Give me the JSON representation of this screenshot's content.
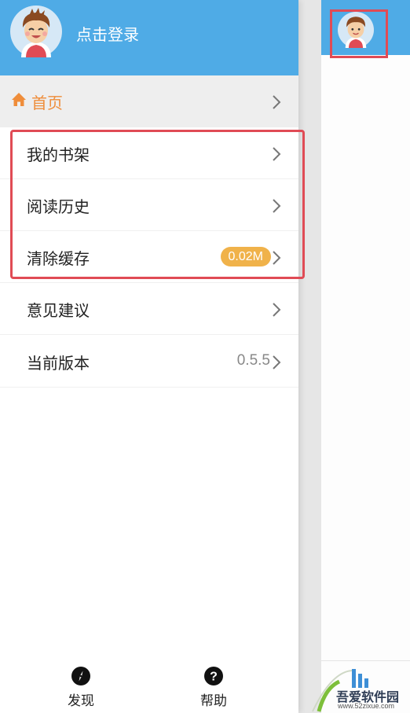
{
  "header": {
    "login_label": "点击登录"
  },
  "menu": {
    "home_label": "首页",
    "items": [
      {
        "label": "我的书架"
      },
      {
        "label": "阅读历史"
      },
      {
        "label": "清除缓存",
        "badge": "0.02M"
      },
      {
        "label": "意见建议"
      },
      {
        "label": "当前版本",
        "value": "0.5.5"
      }
    ]
  },
  "bottom_nav": {
    "discover_label": "发现",
    "help_label": "帮助"
  },
  "watermark": {
    "text": "吾爱软件园",
    "url": "www.52zixue.com"
  },
  "colors": {
    "header_blue": "#4fabe6",
    "accent_orange": "#ef8d3a",
    "badge_orange": "#f0b24a",
    "highlight_red": "#e04b55"
  }
}
